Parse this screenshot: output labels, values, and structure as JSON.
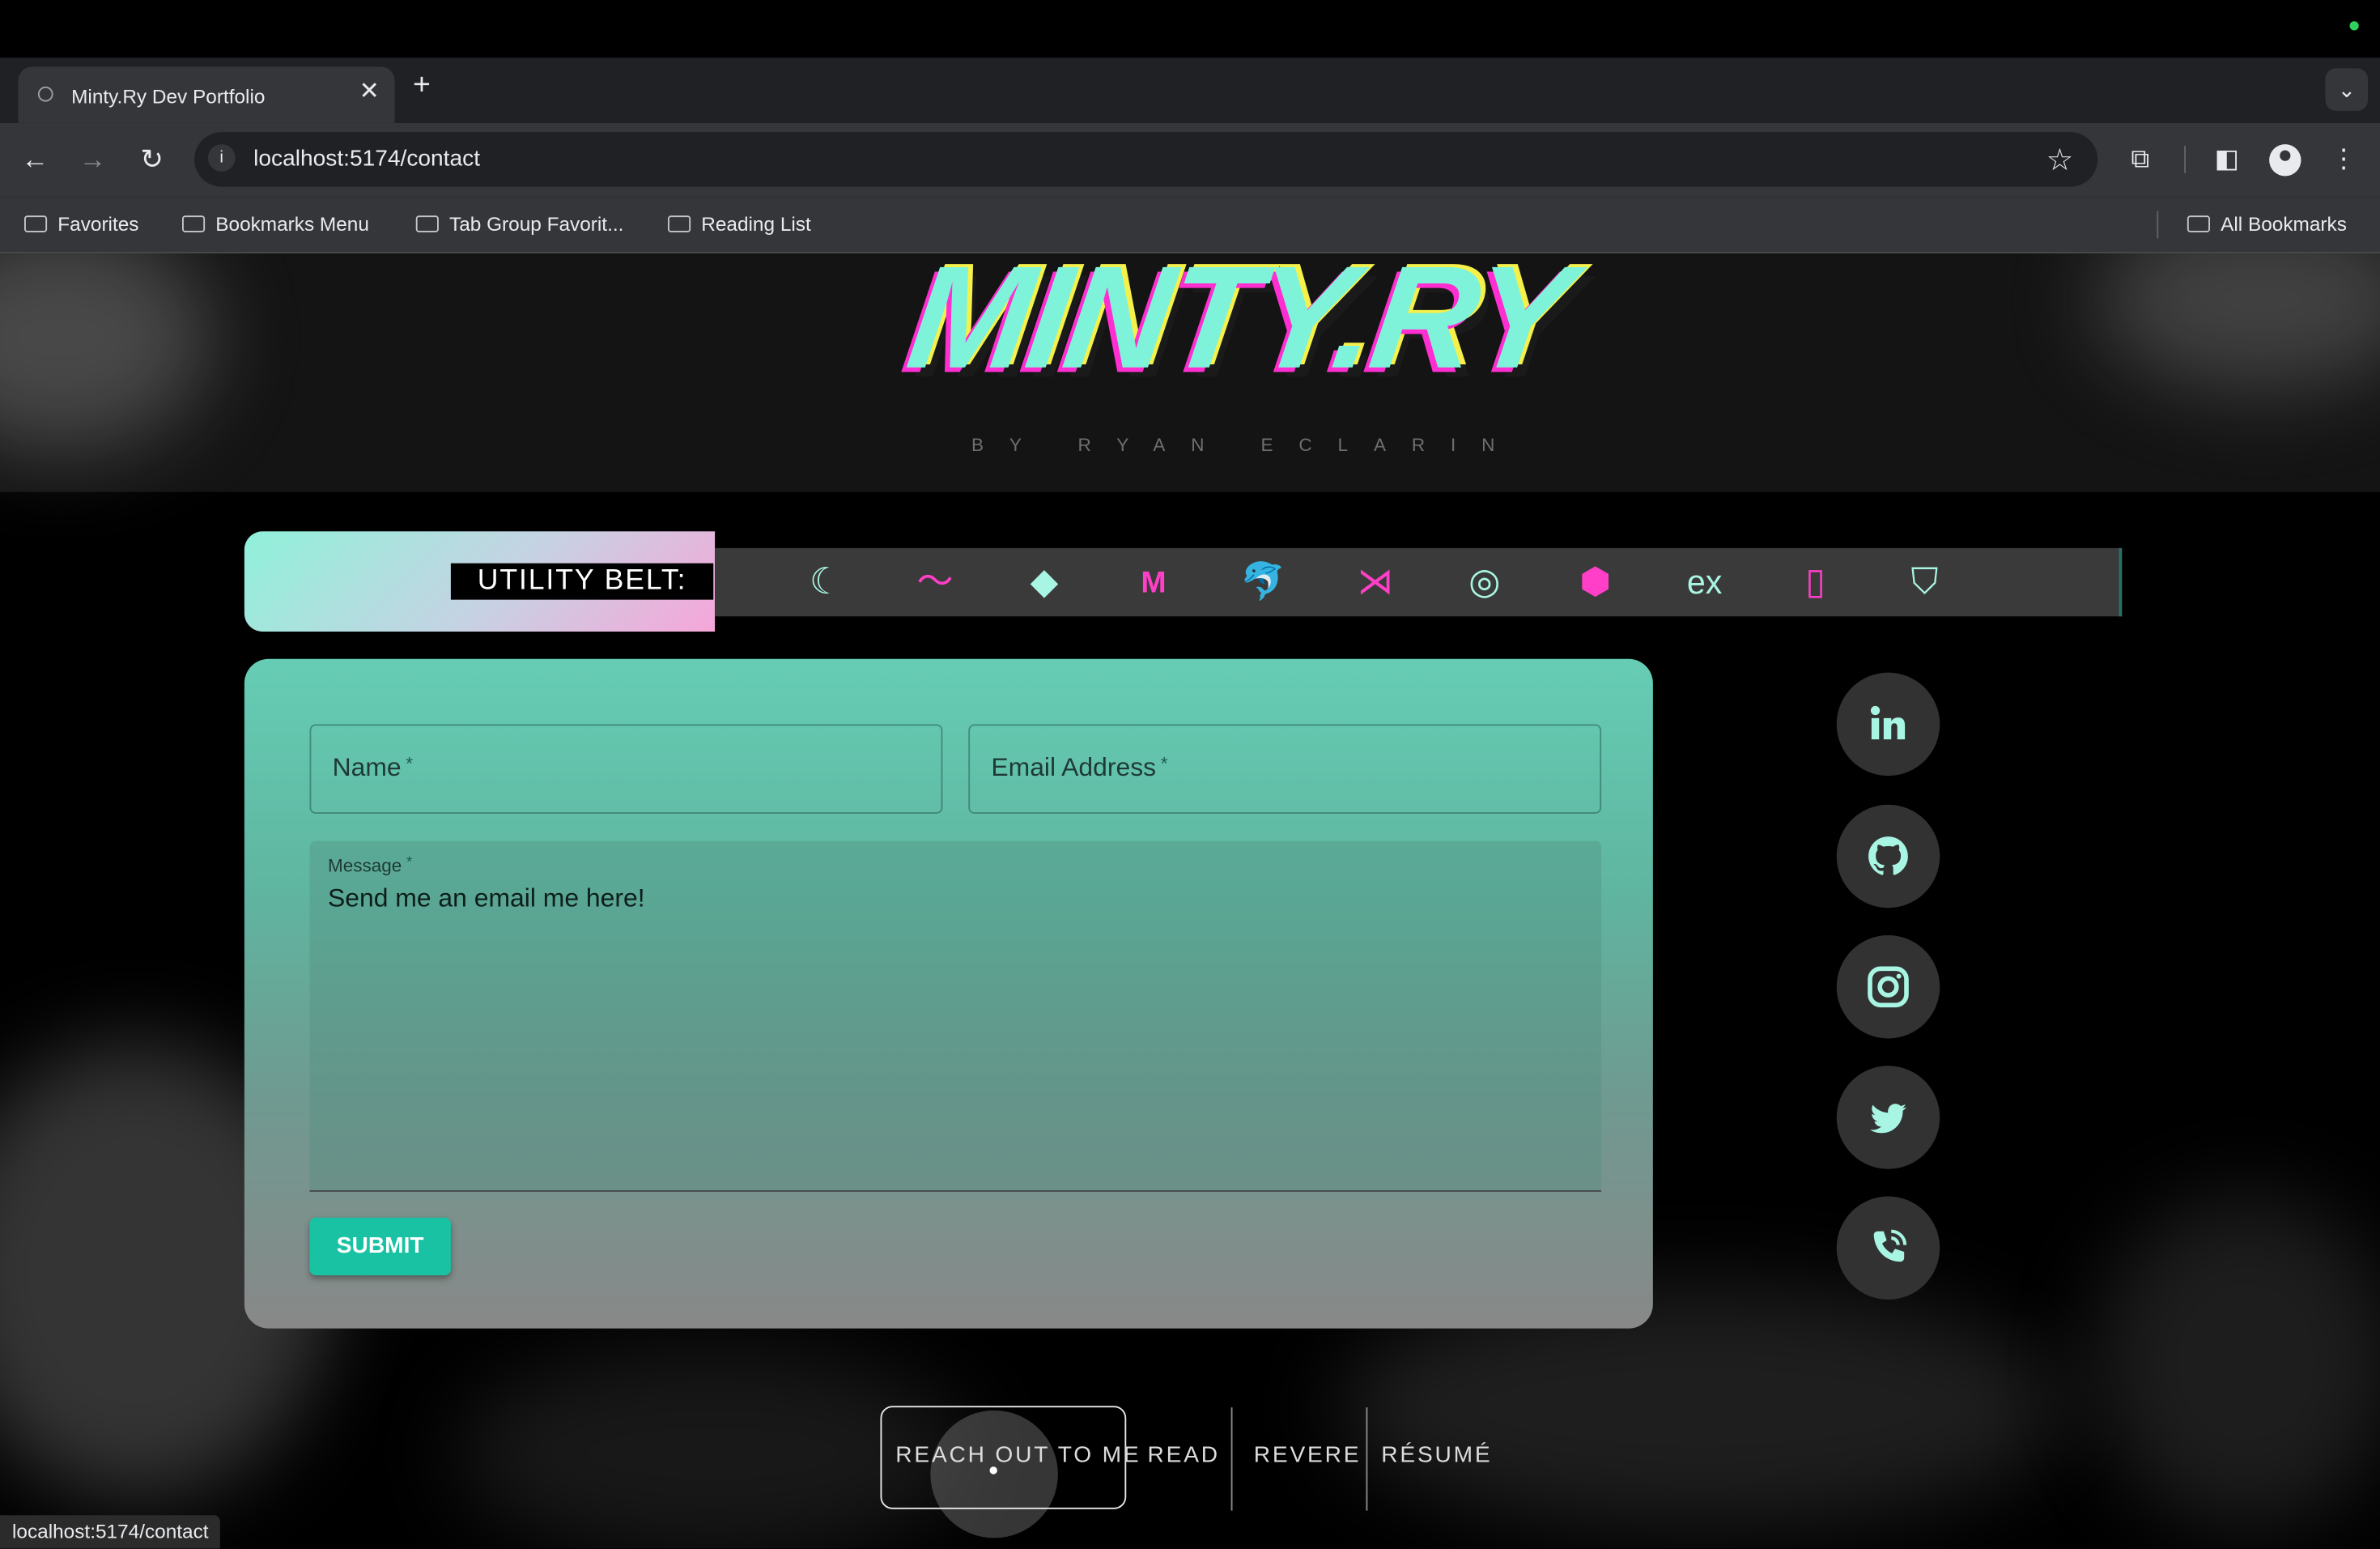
{
  "browser": {
    "tab_title": "Minty.Ry Dev Portfolio",
    "url": "localhost:5174/contact",
    "bookmarks": [
      "Favorites",
      "Bookmarks Menu",
      "Tab Group Favorit...",
      "Reading List"
    ],
    "all_bookmarks": "All Bookmarks",
    "status_url": "localhost:5174/contact"
  },
  "header": {
    "logo": "MINTY.RY",
    "byline": "BY RYAN ECLARIN"
  },
  "utility_belt": {
    "label": "UTILITY BELT:",
    "icons": [
      "apple-icon",
      "jquery-icon",
      "styled-components-icon",
      "bitbucket-icon",
      "material-ui-icon",
      "mysql-icon",
      "visual-studio-code-icon",
      "chrome-icon",
      "material-design-icon",
      "express-icon",
      "heroku-icon",
      "codepen-icon"
    ]
  },
  "contact_form": {
    "name_label": "Name",
    "email_label": "Email Address",
    "required_mark": "*",
    "message_label": "Message",
    "message_value": "Send me an email me here!",
    "submit_label": "SUBMIT"
  },
  "socials": [
    "linkedin-icon",
    "github-icon",
    "instagram-icon",
    "twitter-icon",
    "phone-icon"
  ],
  "bottom_nav": {
    "items": [
      "REACH OUT TO ME",
      "READ",
      "REVERE",
      "RÉSUMÉ"
    ],
    "active": "REACH OUT TO ME"
  },
  "colors": {
    "mint": "#7ff3d9",
    "pink": "#ff2ed1",
    "accent_button": "#19c2a3"
  }
}
